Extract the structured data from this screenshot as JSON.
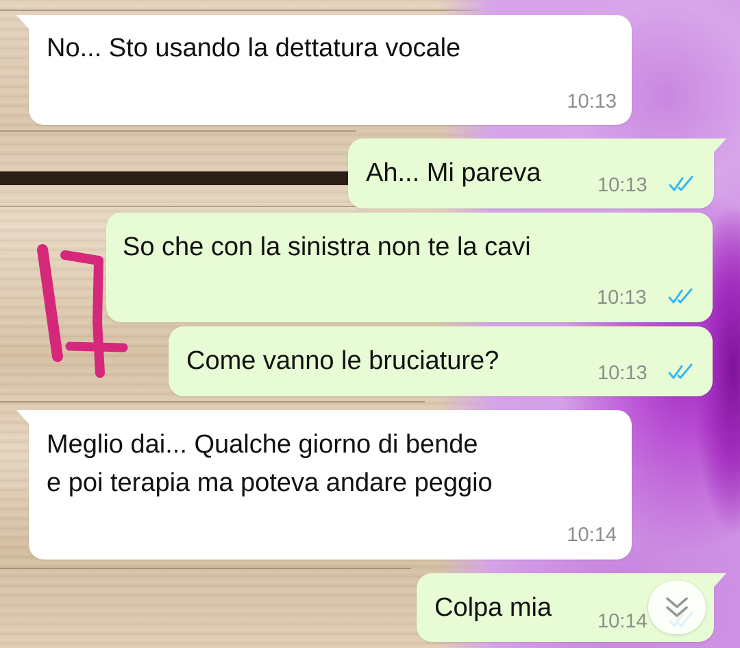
{
  "chat": {
    "messages": [
      {
        "direction": "incoming",
        "text": "No... Sto usando la dettatura vocale",
        "time": "10:13"
      },
      {
        "direction": "outgoing",
        "text": "Ah... Mi pareva",
        "time": "10:13",
        "status": "read"
      },
      {
        "direction": "outgoing",
        "text": "So che con la sinistra non te la cavi",
        "time": "10:13",
        "status": "read"
      },
      {
        "direction": "outgoing",
        "text": "Come vanno le bruciature?",
        "time": "10:13",
        "status": "read"
      },
      {
        "direction": "incoming",
        "lines": [
          "Meglio dai... Qualche giorno di bende",
          "e poi terapia ma poteva andare peggio"
        ],
        "time": "10:14"
      },
      {
        "direction": "outgoing",
        "text": "Colpa mia",
        "time": "10:14",
        "status": "read"
      }
    ]
  },
  "icons": {
    "read_receipt": "double-check-icon",
    "scroll_down": "double-chevron-down-icon",
    "annotation": "handwritten-annotation-icon"
  },
  "colors": {
    "incoming_bubble": "#ffffff",
    "outgoing_bubble": "#e7fcd4",
    "read_tick": "#34b7f1",
    "annotation": "#d6287a"
  }
}
